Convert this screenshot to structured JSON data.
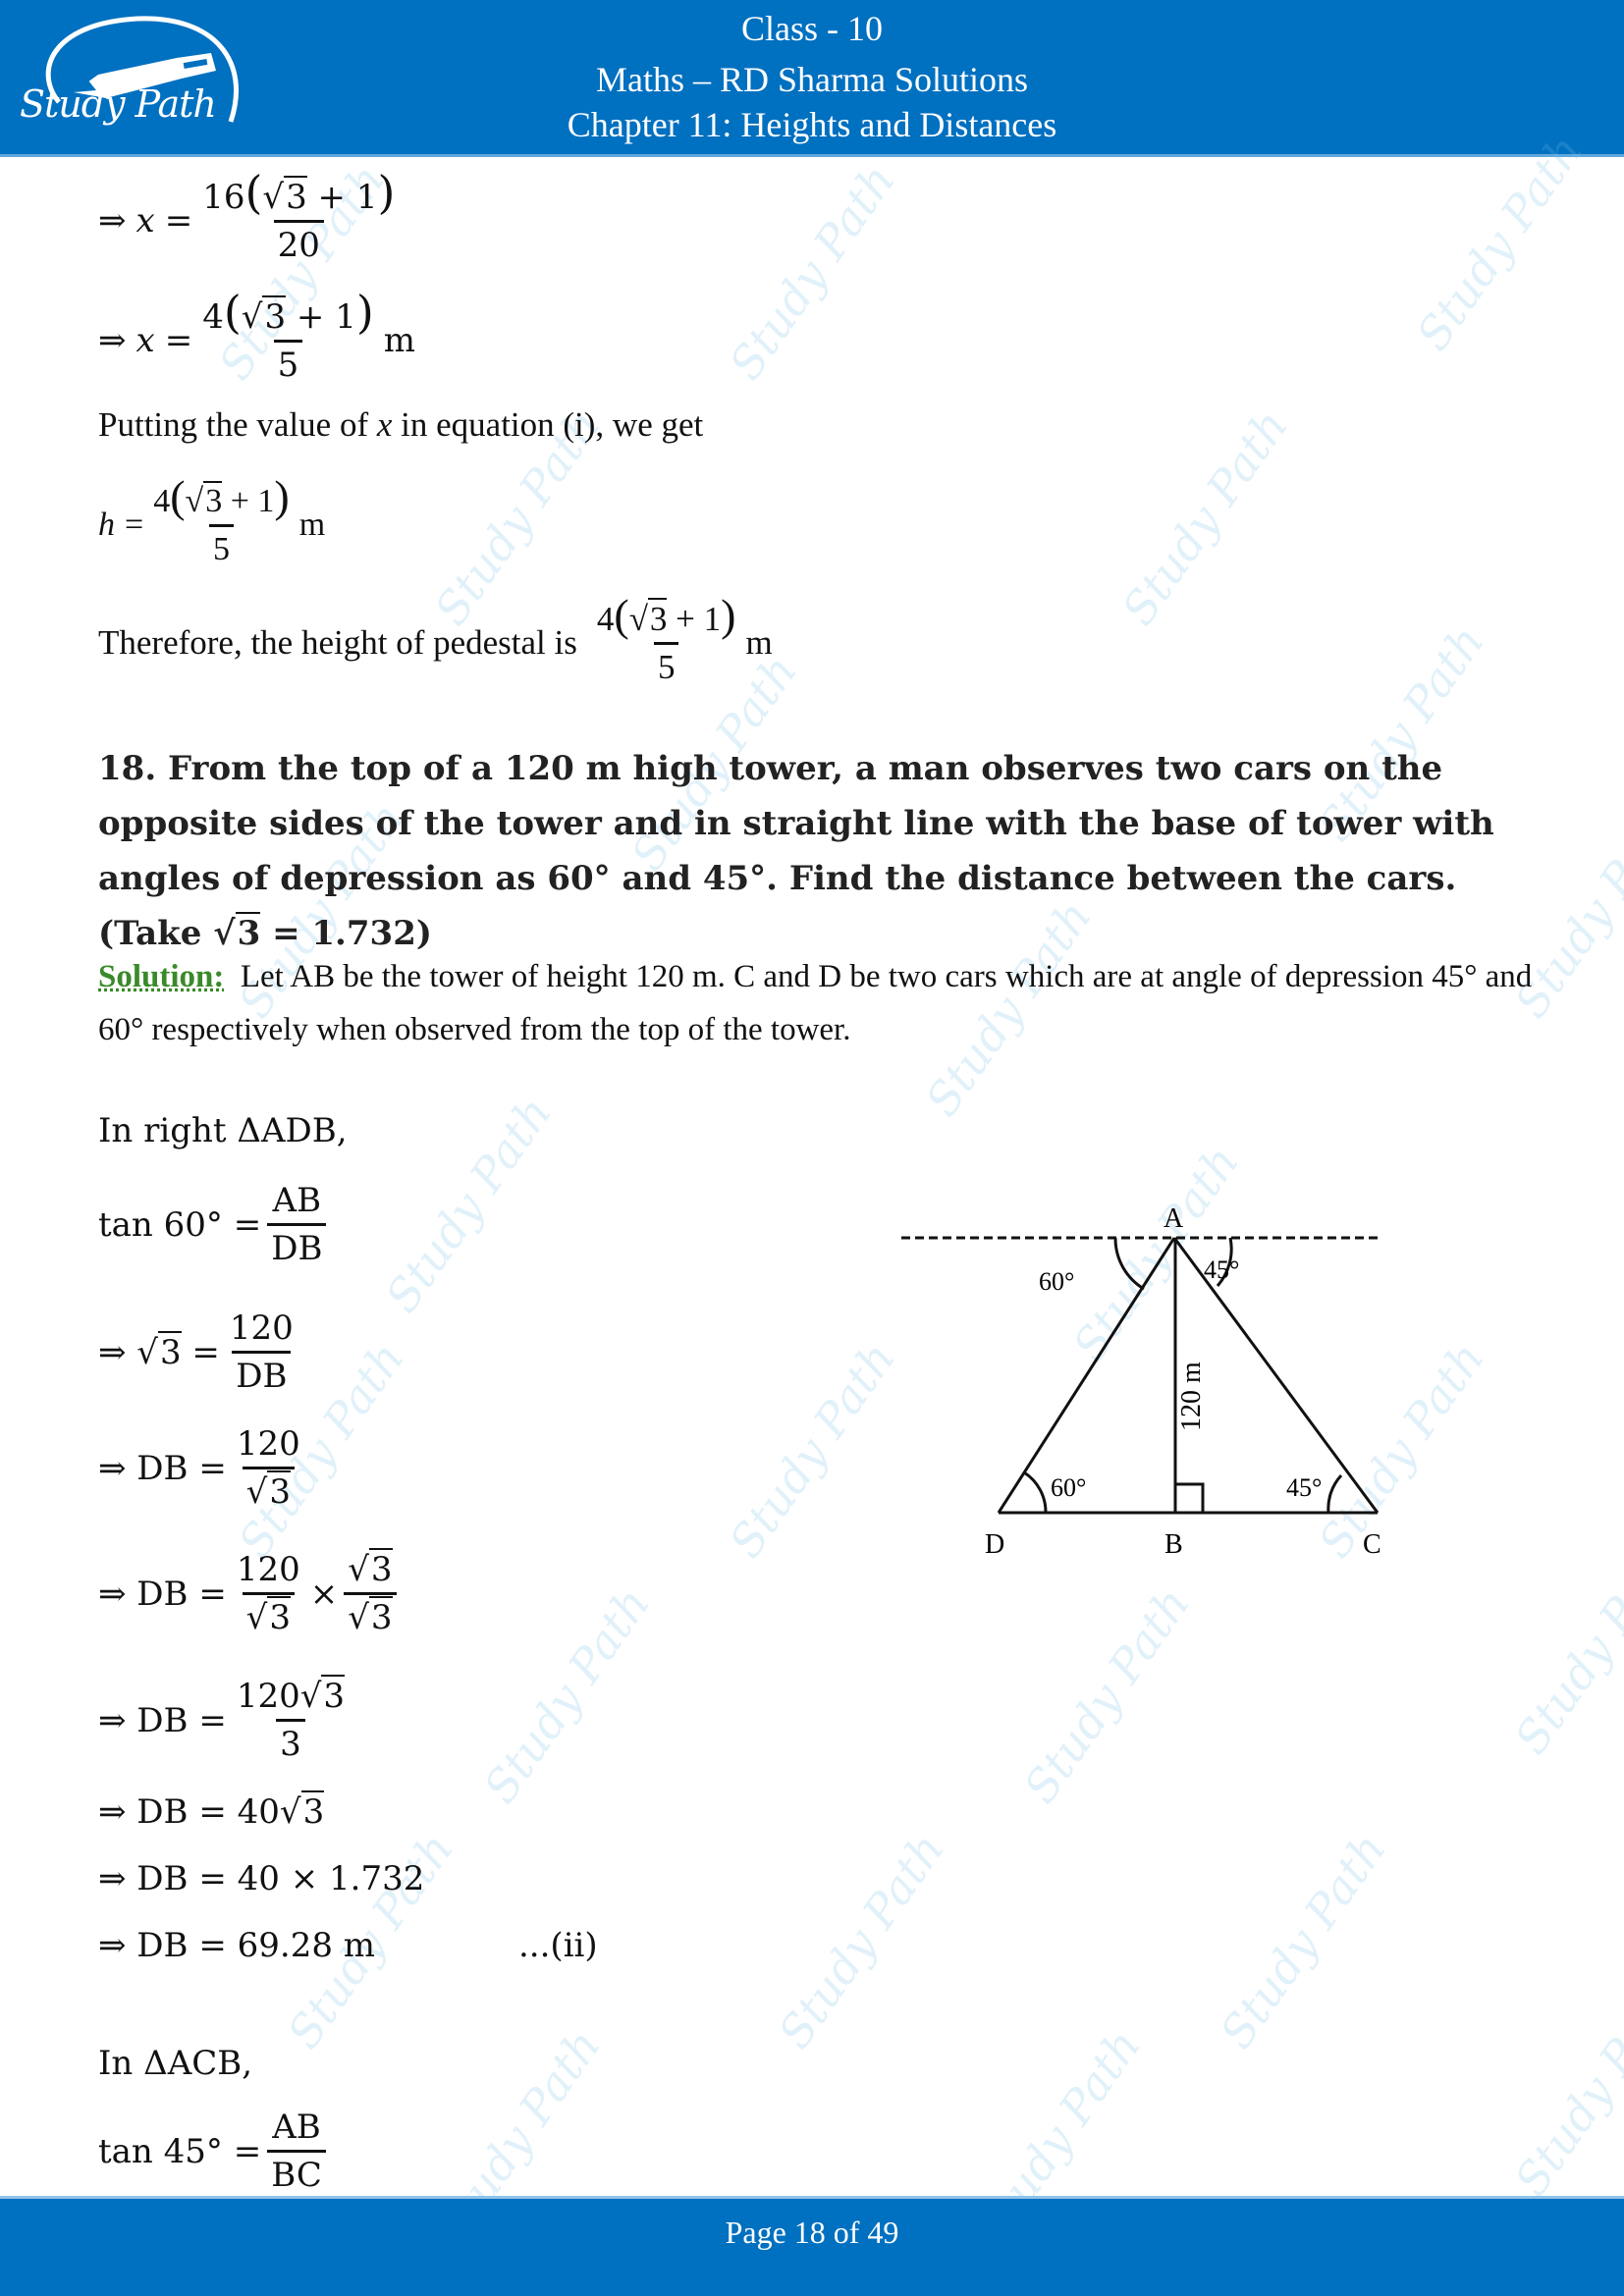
{
  "header": {
    "class_label": "Class - 10",
    "subject_label": "Maths – RD Sharma Solutions",
    "chapter_label": "Chapter 11: Heights and Distances",
    "logo_text": "Study Path",
    "color": "#0070c0"
  },
  "watermark_text": "Study Path",
  "prev_solution": {
    "eq1": {
      "prefix": "⇒",
      "lhs": "x",
      "num_coef": "16",
      "num_inner": "3",
      "num_plus": "+ 1",
      "den": "20"
    },
    "eq2": {
      "prefix": "⇒",
      "lhs": "x",
      "num_coef": "4",
      "num_inner": "3",
      "num_plus": "+ 1",
      "den": "5",
      "unit": "m"
    },
    "putting_text_a": "Putting the value of ",
    "putting_var": "x",
    "putting_text_b": " in equation (i), we get",
    "eq3": {
      "lhs": "h",
      "num_coef": "4",
      "num_inner": "3",
      "num_plus": "+ 1",
      "den": "5",
      "unit": "m"
    },
    "therefore_text": "Therefore, the height of pedestal is",
    "therefore_frac": {
      "num_coef": "4",
      "num_inner": "3",
      "num_plus": "+ 1",
      "den": "5",
      "unit": "m"
    }
  },
  "question": {
    "number": "18.",
    "text_a": "From the top of a 120 m high tower, a man observes two cars on the opposite sides of the tower and in straight line with the base of tower with angles of depression as 60° and 45°. Find the distance between the cars. (Take ",
    "sqrt_val": "3",
    "text_b": " = 1.732)"
  },
  "solution": {
    "label": "Solution:",
    "text": "Let AB be the tower of height 120 m.  C and D be two cars which are at angle of depression  45° and 60° respectively when observed from the top of the tower.",
    "label_color": "#3a8a2a"
  },
  "steps": {
    "in_right_adb": "In right ΔADB,",
    "tan60": {
      "lhs": "tan 60° =",
      "num": "AB",
      "den": "DB"
    },
    "s1": {
      "lhs": "⇒ ",
      "sqrt": "3",
      "eq": " =",
      "num": "120",
      "den": "DB"
    },
    "s2": {
      "lhs": "⇒ DB =",
      "num": "120",
      "den_sqrt": "3"
    },
    "s3": {
      "lhs": "⇒ DB =",
      "num": "120",
      "den_sqrt": "3",
      "times": "×",
      "num2_sqrt": "3",
      "den2_sqrt": "3"
    },
    "s4": {
      "lhs": "⇒ DB =",
      "num": "120",
      "num_sqrt": "3",
      "den": "3"
    },
    "s5": {
      "lhs": "⇒ DB = 40",
      "sqrt": "3"
    },
    "s6": {
      "text": "⇒ DB = 40 × 1.732"
    },
    "s7": {
      "text": "⇒ DB = 69.28 m",
      "tag": "...(ii)"
    },
    "in_acb": "In ΔACB,",
    "tan45": {
      "lhs": "tan 45° =",
      "num": "AB",
      "den": "BC"
    }
  },
  "diagram": {
    "labels": {
      "A": "A",
      "B": "B",
      "C": "C",
      "D": "D"
    },
    "height_label": "120 m",
    "angle_top_left": "60°",
    "angle_top_right": "45°",
    "angle_D": "60°",
    "angle_C": "45°"
  },
  "footer": {
    "page_prefix": "Page ",
    "page_current": "18",
    "page_mid": " of ",
    "page_total": "49"
  }
}
